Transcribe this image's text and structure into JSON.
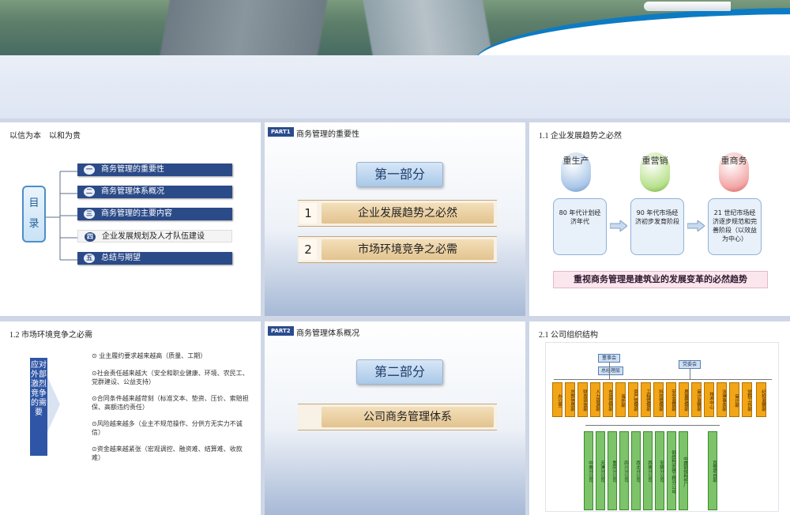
{
  "slides": {
    "s1": {
      "title": "以信为本　以和为贵",
      "mulu": [
        "目",
        "录"
      ],
      "items": [
        {
          "num": "一",
          "label": "商务管理的重要性"
        },
        {
          "num": "二",
          "label": "商务管理体系概况"
        },
        {
          "num": "三",
          "label": "商务管理的主要内容"
        },
        {
          "num": "四",
          "label": "企业发展规划及人才队伍建设"
        },
        {
          "num": "五",
          "label": "总结与期望"
        }
      ]
    },
    "s2": {
      "tag": "PART1",
      "title": "商务管理的重要性",
      "part": "第一部分",
      "rows": [
        {
          "num": "1",
          "text": "企业发展趋势之必然"
        },
        {
          "num": "2",
          "text": "市场环境竞争之必需"
        }
      ]
    },
    "s3": {
      "title": "1.1  企业发展趋势之必然",
      "bubbles": [
        "重生产",
        "重营销",
        "重商务"
      ],
      "stages": [
        "80 年代计划经济年代",
        "90 年代市场经济初步发育阶段",
        "21 世纪市场经济逐步规范和完善阶段（以效益为中心）"
      ],
      "banner": "重视商务管理是建筑业的发展变革的必然趋势"
    },
    "s4": {
      "title": "1.2  市场环境竞争之必需",
      "vlabel": "应对外部激烈竞争的需要",
      "bullets": [
        "⊙ 业主履约要求越来越高（质量、工期）",
        "⊙社会责任越来越大（安全和职业健康、环境、农民工、党群建设、公益支持）",
        "⊙合同条件越来越苛刻（标准文本、垫资、压价、索赔担保、高额违约责任）",
        "⊙风险越来越多（业主不规范操作、分供方无实力不诚信）",
        "⊙资金越来越紧张（宏观调控、融资难、结算难、收款难）"
      ]
    },
    "s5": {
      "tag": "PART2",
      "title": "商务管理体系概况",
      "part": "第二部分",
      "row": "公司商务管理体系"
    },
    "s6": {
      "title": "2.1  公司组织结构",
      "org": {
        "board": "董事会",
        "gm": "总经理层",
        "party": "党委会",
        "depts": [
          "办公室",
          "总部信息部",
          "财务资金部",
          "人力资源部",
          "市场营销部",
          "海外部",
          "资产管理部",
          "工程管理部",
          "科技管理部",
          "安全监督部",
          "质量管理部",
          "审计监察部",
          "技术中心",
          "法律事务部",
          "审计部",
          "党群工作部",
          "纪检监察部"
        ],
        "branches": [
          "中南分公司",
          "天津分公司",
          "重庆分公司",
          "四川分公司",
          "西北分公司",
          "西南分公司",
          "安装分公司",
          "钢结构安装工程分公司",
          "中建钢铁构件厂"
        ],
        "extra": "直营项目部"
      }
    }
  },
  "colors": {
    "navy": "#2b4a88",
    "accent": "#1a88cf",
    "orange": "#f2a516",
    "green": "#7cc36a"
  }
}
